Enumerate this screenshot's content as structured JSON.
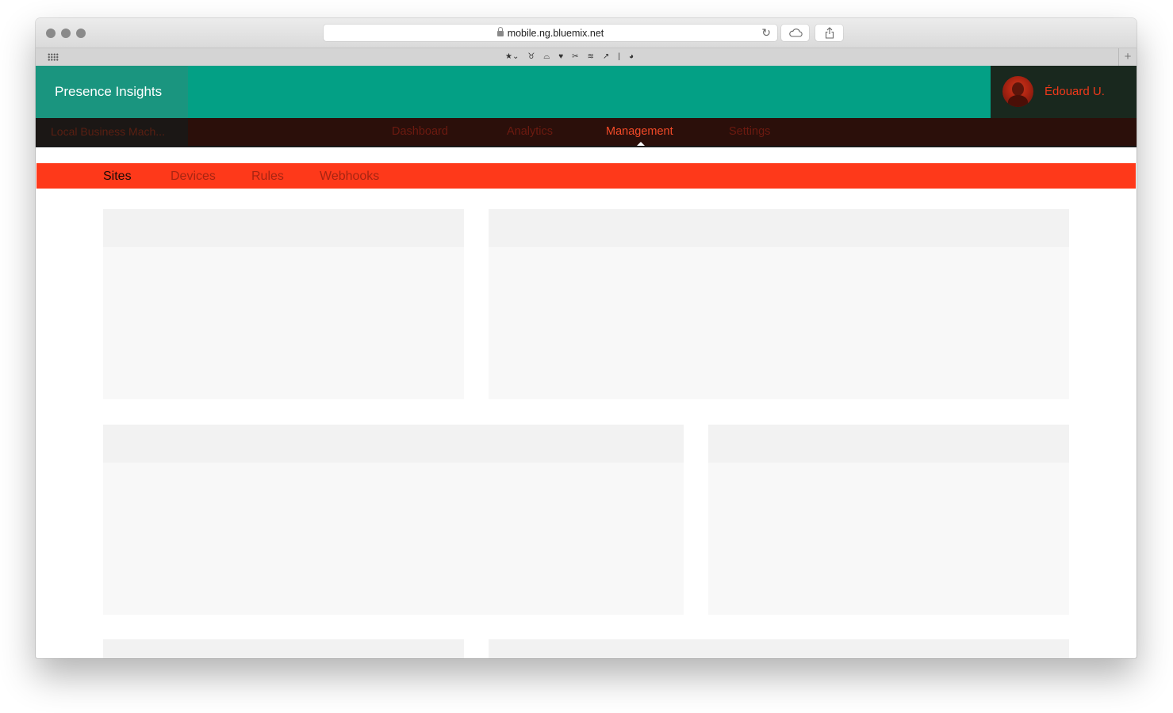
{
  "browser": {
    "url": "mobile.ng.bluemix.net",
    "reload_icon": "reload-icon",
    "icloud_icon": "cloud-icon",
    "share_icon": "share-icon",
    "bookmark_icons": [
      "★⌄",
      "♉",
      "⌓",
      "♥",
      "✂",
      "≋",
      "↗",
      "|",
      "◕"
    ]
  },
  "app": {
    "brand": "Presence Insights",
    "user_name": "Édouard U.",
    "organization": "Local Business Mach..."
  },
  "main_nav": {
    "items": [
      {
        "label": "Dashboard"
      },
      {
        "label": "Analytics"
      },
      {
        "label": "Management"
      },
      {
        "label": "Settings"
      }
    ],
    "active": "Management"
  },
  "sub_nav": {
    "items": [
      {
        "label": "Sites"
      },
      {
        "label": "Devices"
      },
      {
        "label": "Rules"
      },
      {
        "label": "Webhooks"
      }
    ],
    "active": "Sites"
  },
  "colors": {
    "header": "#03a085",
    "nav_bar": "#2b0f0a",
    "sub_nav": "#fe391a",
    "accent": "#f34a28"
  }
}
